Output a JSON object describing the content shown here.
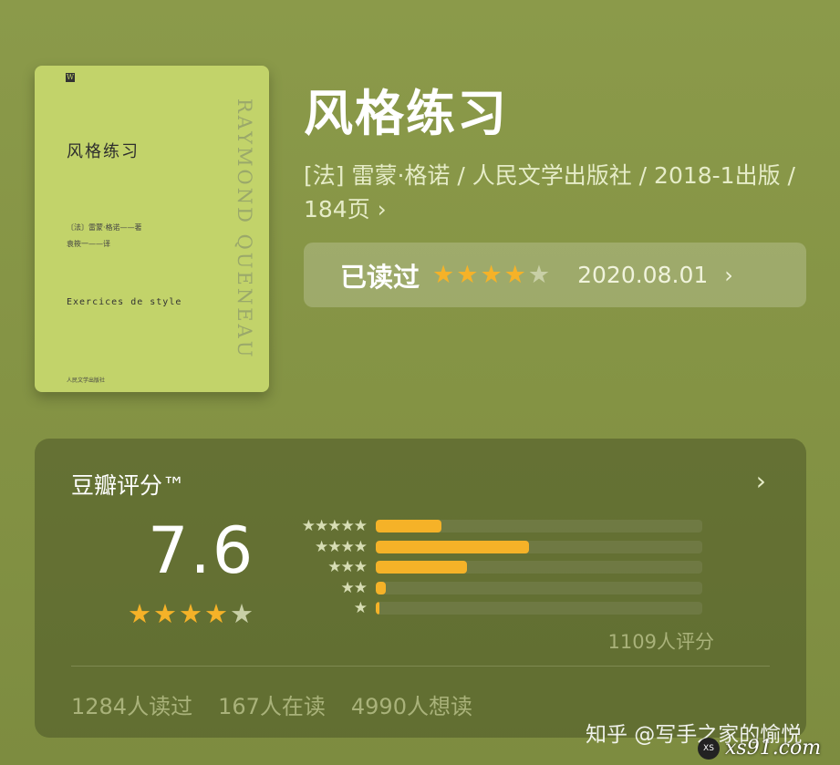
{
  "cover": {
    "publisher_series": "W",
    "series_text": "",
    "title": "风格练习",
    "author": "〔法〕雷蒙·格诺——著",
    "translator": "袁筱一——译",
    "subtitle": "Exercices de style",
    "publisher": "人民文学出版社",
    "spine_text": "RAYMOND QUENEAU"
  },
  "book": {
    "title": "风格练习",
    "meta": "[法] 雷蒙·格诺 / 人民文学出版社 / 2018-1出版 / 184页",
    "meta_chevron": "›"
  },
  "read_status": {
    "label": "已读过",
    "stars_filled": 4,
    "stars_total": 5,
    "date": "2020.08.01",
    "chevron": "›"
  },
  "rating": {
    "title": "豆瓣评分™",
    "chevron": "›",
    "score": "7.6",
    "stars_filled": 4,
    "stars_total": 5,
    "distribution": [
      {
        "stars": 5,
        "fraction": 0.2
      },
      {
        "stars": 4,
        "fraction": 0.47
      },
      {
        "stars": 3,
        "fraction": 0.28
      },
      {
        "stars": 2,
        "fraction": 0.03
      },
      {
        "stars": 1,
        "fraction": 0.01
      }
    ],
    "count_text": "1109人评分",
    "read_count": "1284人读过",
    "reading_count": "167人在读",
    "want_count": "4990人想读"
  },
  "watermark": {
    "text": "知乎 @写手之家的愉悦",
    "site": "xs91.com",
    "logo": "XS"
  },
  "colors": {
    "accent_star": "#f5b228",
    "background": "#859445",
    "cover": "#c2d36a"
  },
  "icons": {
    "star": "★",
    "chevron": "chevron-right-icon"
  }
}
